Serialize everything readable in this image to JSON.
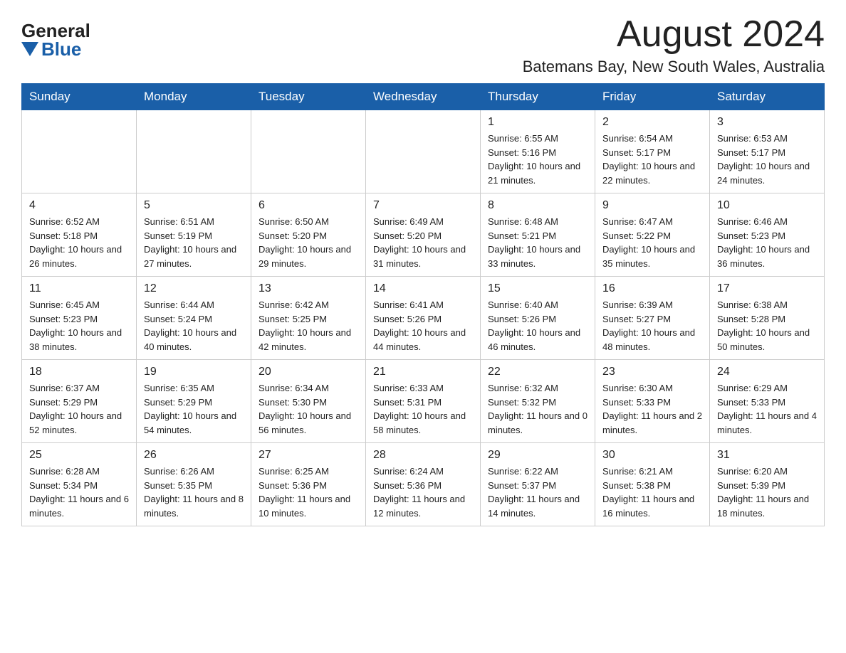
{
  "header": {
    "logo_general": "General",
    "logo_blue": "Blue",
    "month_title": "August 2024",
    "location": "Batemans Bay, New South Wales, Australia"
  },
  "days_of_week": [
    "Sunday",
    "Monday",
    "Tuesday",
    "Wednesday",
    "Thursday",
    "Friday",
    "Saturday"
  ],
  "weeks": [
    [
      {
        "day": "",
        "info": ""
      },
      {
        "day": "",
        "info": ""
      },
      {
        "day": "",
        "info": ""
      },
      {
        "day": "",
        "info": ""
      },
      {
        "day": "1",
        "info": "Sunrise: 6:55 AM\nSunset: 5:16 PM\nDaylight: 10 hours and 21 minutes."
      },
      {
        "day": "2",
        "info": "Sunrise: 6:54 AM\nSunset: 5:17 PM\nDaylight: 10 hours and 22 minutes."
      },
      {
        "day": "3",
        "info": "Sunrise: 6:53 AM\nSunset: 5:17 PM\nDaylight: 10 hours and 24 minutes."
      }
    ],
    [
      {
        "day": "4",
        "info": "Sunrise: 6:52 AM\nSunset: 5:18 PM\nDaylight: 10 hours and 26 minutes."
      },
      {
        "day": "5",
        "info": "Sunrise: 6:51 AM\nSunset: 5:19 PM\nDaylight: 10 hours and 27 minutes."
      },
      {
        "day": "6",
        "info": "Sunrise: 6:50 AM\nSunset: 5:20 PM\nDaylight: 10 hours and 29 minutes."
      },
      {
        "day": "7",
        "info": "Sunrise: 6:49 AM\nSunset: 5:20 PM\nDaylight: 10 hours and 31 minutes."
      },
      {
        "day": "8",
        "info": "Sunrise: 6:48 AM\nSunset: 5:21 PM\nDaylight: 10 hours and 33 minutes."
      },
      {
        "day": "9",
        "info": "Sunrise: 6:47 AM\nSunset: 5:22 PM\nDaylight: 10 hours and 35 minutes."
      },
      {
        "day": "10",
        "info": "Sunrise: 6:46 AM\nSunset: 5:23 PM\nDaylight: 10 hours and 36 minutes."
      }
    ],
    [
      {
        "day": "11",
        "info": "Sunrise: 6:45 AM\nSunset: 5:23 PM\nDaylight: 10 hours and 38 minutes."
      },
      {
        "day": "12",
        "info": "Sunrise: 6:44 AM\nSunset: 5:24 PM\nDaylight: 10 hours and 40 minutes."
      },
      {
        "day": "13",
        "info": "Sunrise: 6:42 AM\nSunset: 5:25 PM\nDaylight: 10 hours and 42 minutes."
      },
      {
        "day": "14",
        "info": "Sunrise: 6:41 AM\nSunset: 5:26 PM\nDaylight: 10 hours and 44 minutes."
      },
      {
        "day": "15",
        "info": "Sunrise: 6:40 AM\nSunset: 5:26 PM\nDaylight: 10 hours and 46 minutes."
      },
      {
        "day": "16",
        "info": "Sunrise: 6:39 AM\nSunset: 5:27 PM\nDaylight: 10 hours and 48 minutes."
      },
      {
        "day": "17",
        "info": "Sunrise: 6:38 AM\nSunset: 5:28 PM\nDaylight: 10 hours and 50 minutes."
      }
    ],
    [
      {
        "day": "18",
        "info": "Sunrise: 6:37 AM\nSunset: 5:29 PM\nDaylight: 10 hours and 52 minutes."
      },
      {
        "day": "19",
        "info": "Sunrise: 6:35 AM\nSunset: 5:29 PM\nDaylight: 10 hours and 54 minutes."
      },
      {
        "day": "20",
        "info": "Sunrise: 6:34 AM\nSunset: 5:30 PM\nDaylight: 10 hours and 56 minutes."
      },
      {
        "day": "21",
        "info": "Sunrise: 6:33 AM\nSunset: 5:31 PM\nDaylight: 10 hours and 58 minutes."
      },
      {
        "day": "22",
        "info": "Sunrise: 6:32 AM\nSunset: 5:32 PM\nDaylight: 11 hours and 0 minutes."
      },
      {
        "day": "23",
        "info": "Sunrise: 6:30 AM\nSunset: 5:33 PM\nDaylight: 11 hours and 2 minutes."
      },
      {
        "day": "24",
        "info": "Sunrise: 6:29 AM\nSunset: 5:33 PM\nDaylight: 11 hours and 4 minutes."
      }
    ],
    [
      {
        "day": "25",
        "info": "Sunrise: 6:28 AM\nSunset: 5:34 PM\nDaylight: 11 hours and 6 minutes."
      },
      {
        "day": "26",
        "info": "Sunrise: 6:26 AM\nSunset: 5:35 PM\nDaylight: 11 hours and 8 minutes."
      },
      {
        "day": "27",
        "info": "Sunrise: 6:25 AM\nSunset: 5:36 PM\nDaylight: 11 hours and 10 minutes."
      },
      {
        "day": "28",
        "info": "Sunrise: 6:24 AM\nSunset: 5:36 PM\nDaylight: 11 hours and 12 minutes."
      },
      {
        "day": "29",
        "info": "Sunrise: 6:22 AM\nSunset: 5:37 PM\nDaylight: 11 hours and 14 minutes."
      },
      {
        "day": "30",
        "info": "Sunrise: 6:21 AM\nSunset: 5:38 PM\nDaylight: 11 hours and 16 minutes."
      },
      {
        "day": "31",
        "info": "Sunrise: 6:20 AM\nSunset: 5:39 PM\nDaylight: 11 hours and 18 minutes."
      }
    ]
  ]
}
